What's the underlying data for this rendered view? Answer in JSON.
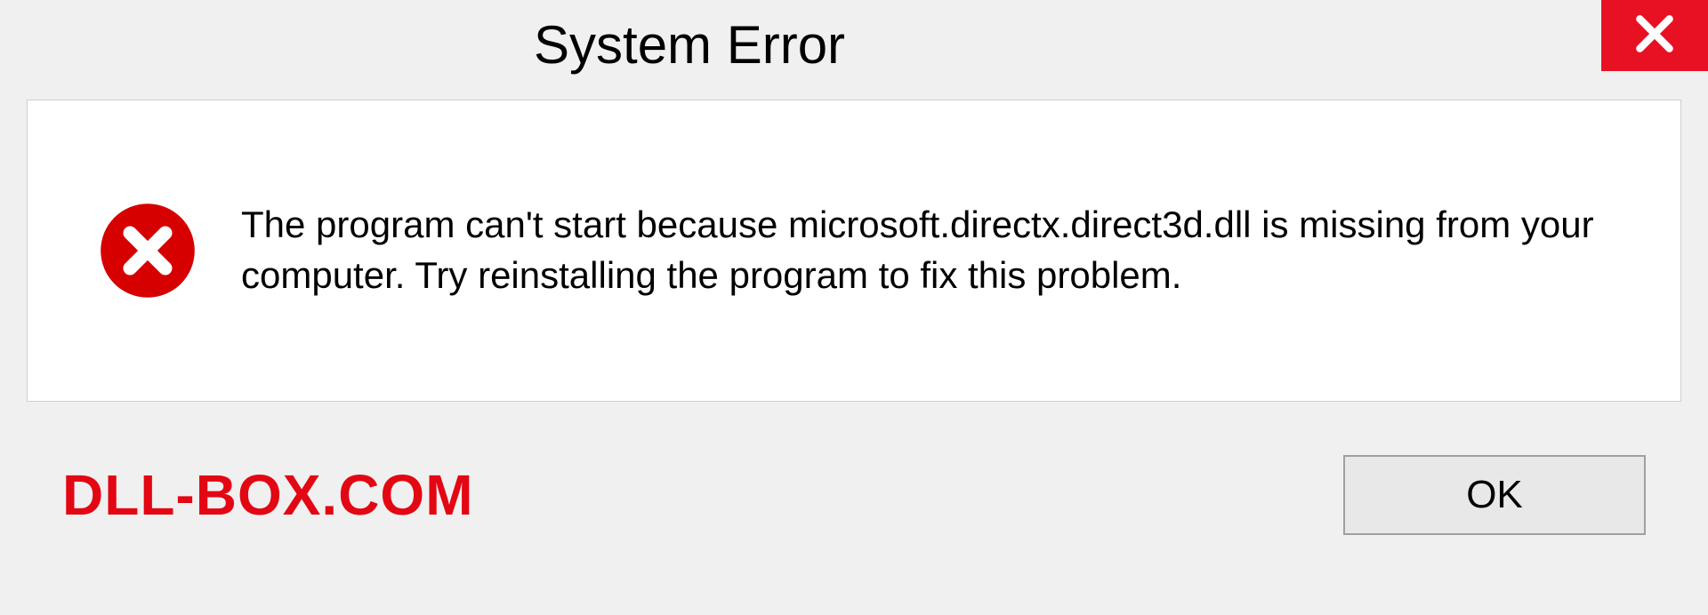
{
  "titlebar": {
    "title": "System Error"
  },
  "content": {
    "message": "The program can't start because microsoft.directx.direct3d.dll is missing from your computer. Try reinstalling the program to fix this problem."
  },
  "footer": {
    "watermark": "DLL-BOX.COM",
    "ok_label": "OK"
  },
  "colors": {
    "close_bg": "#e81123",
    "error_icon": "#d60000",
    "watermark": "#e30613"
  }
}
